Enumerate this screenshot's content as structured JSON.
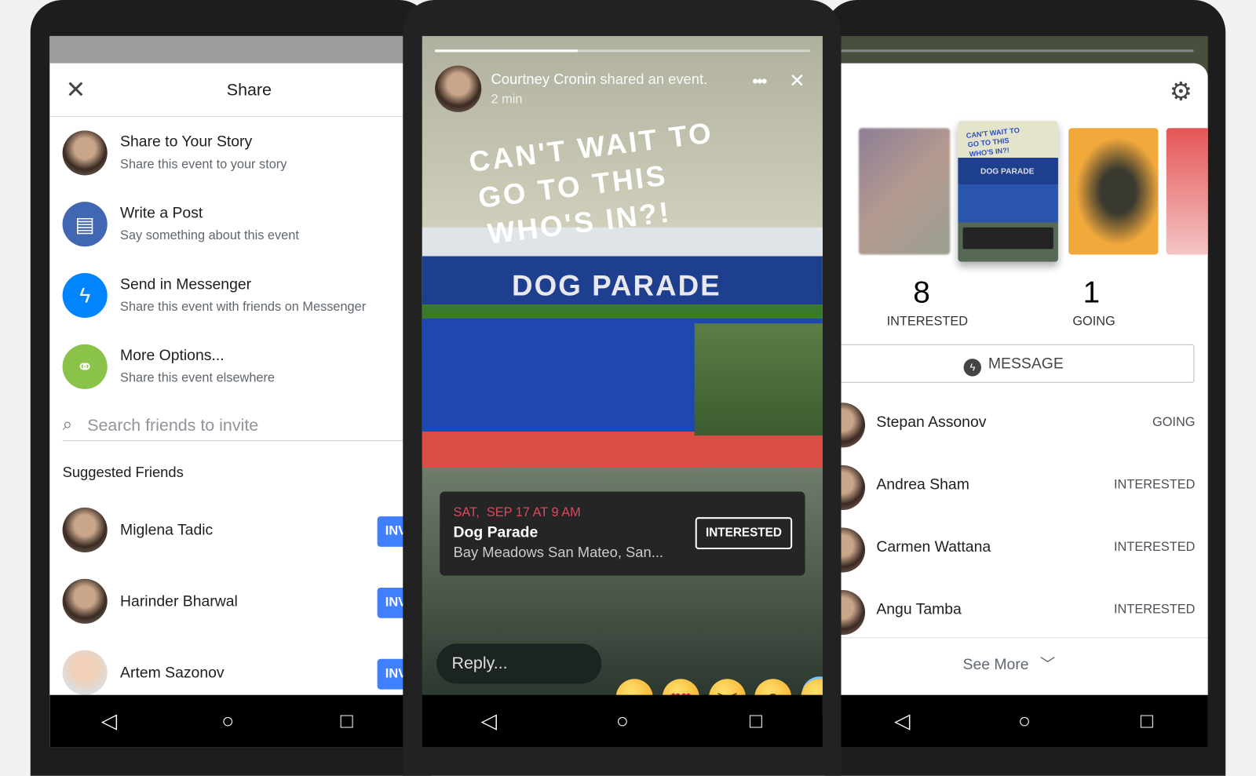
{
  "share_screen": {
    "close_icon": "close-icon",
    "title": "Share",
    "options": [
      {
        "title": "Share to Your Story",
        "subtitle": "Share this event to your story",
        "icon": "avatar"
      },
      {
        "title": "Write a Post",
        "subtitle": "Say something about this event",
        "icon": "post-icon",
        "color": "#4267b2"
      },
      {
        "title": "Send in Messenger",
        "subtitle": "Share this event with friends on Messenger",
        "icon": "messenger-icon",
        "color": "#0084ff"
      },
      {
        "title": "More Options...",
        "subtitle": "Share this event elsewhere",
        "icon": "link-icon",
        "color": "#8bc34a"
      }
    ],
    "search_placeholder": "Search friends to invite",
    "suggested_header": "Suggested Friends",
    "friends": [
      {
        "name": "Miglena Tadic",
        "button": "INV"
      },
      {
        "name": "Harinder Bharwal",
        "button": "INV"
      },
      {
        "name": "Artem Sazonov",
        "button": "INV"
      }
    ]
  },
  "story_screen": {
    "progress": 0.38,
    "author": "Courtney Cronin",
    "action": "shared an event.",
    "time": "2 min",
    "caption": [
      "CAN'T WAIT TO",
      "GO TO THIS",
      "WHO'S IN?!"
    ],
    "banner": "DOG PARADE",
    "event": {
      "date": "SAT,  SEP 17 AT 9 AM",
      "name": "Dog Parade",
      "location": "Bay Meadows San Mateo, San...",
      "button": "INTERESTED"
    },
    "reply_placeholder": "Reply...",
    "reactions": [
      "smile",
      "heart-eyes",
      "laughing",
      "surprised",
      "halo"
    ],
    "date_color": "#e0475e"
  },
  "viewers_screen": {
    "thumb_caption": [
      "CAN'T WAIT TO",
      "GO TO THIS",
      "WHO'S IN?!"
    ],
    "thumb_banner": "DOG PARADE",
    "stats": [
      {
        "count": "8",
        "label": "INTERESTED"
      },
      {
        "count": "1",
        "label": "GOING"
      }
    ],
    "message_button": "MESSAGE",
    "people": [
      {
        "name": "Stepan Assonov",
        "status": "GOING"
      },
      {
        "name": "Andrea Sham",
        "status": "INTERESTED"
      },
      {
        "name": "Carmen Wattana",
        "status": "INTERESTED"
      },
      {
        "name": "Angu Tamba",
        "status": "INTERESTED"
      }
    ],
    "see_more": "See More"
  },
  "nav": {
    "back": "◁",
    "home": "○",
    "recents": "□"
  }
}
